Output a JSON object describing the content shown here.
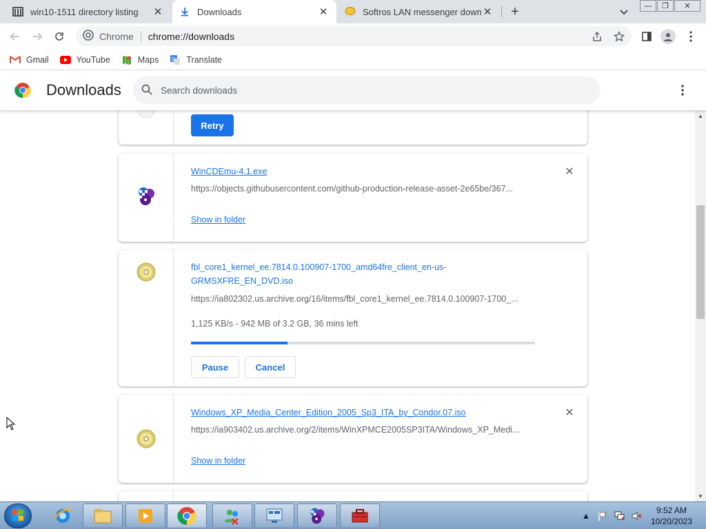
{
  "tabs": [
    {
      "title": "win10-1511 directory listing",
      "icon": "archive-icon"
    },
    {
      "title": "Downloads",
      "icon": "download-icon"
    },
    {
      "title": "Softros LAN messenger downloa",
      "icon": "messenger-icon"
    }
  ],
  "toolbar": {
    "scheme_label": "Chrome",
    "url": "chrome://downloads"
  },
  "bookmarks": [
    {
      "label": "Gmail",
      "icon": "gmail-icon"
    },
    {
      "label": "YouTube",
      "icon": "youtube-icon"
    },
    {
      "label": "Maps",
      "icon": "maps-icon"
    },
    {
      "label": "Translate",
      "icon": "translate-icon"
    }
  ],
  "header": {
    "title": "Downloads",
    "search_placeholder": "Search downloads"
  },
  "downloads": [
    {
      "retry_label": "Retry"
    },
    {
      "filename": "WinCDEmu-4.1.exe",
      "url": "https://objects.githubusercontent.com/github-production-release-asset-2e65be/367...",
      "action_label": "Show in folder"
    },
    {
      "filename": "fbl_core1_kernel_ee.7814.0.100907-1700_amd64fre_client_en-us-GRMSXFRE_EN_DVD.iso",
      "url": "https://ia802302.us.archive.org/16/items/fbl_core1_kernel_ee.7814.0.100907-1700_...",
      "status": "1,125 KB/s - 942 MB of 3.2 GB, 36 mins left",
      "progress_fraction": 0.28,
      "pause_label": "Pause",
      "cancel_label": "Cancel"
    },
    {
      "filename": "Windows_XP_Media_Center_Edition_2005_Sp3_ITA_by_Condor.07.iso",
      "url": "https://ia903402.us.archive.org/2/items/WinXPMCE2005SP3ITA/Windows_XP_Medi...",
      "action_label": "Show in folder"
    }
  ],
  "taskbar": {
    "clock_time": "9:52 AM",
    "clock_date": "10/20/2023"
  },
  "colors": {
    "accent": "#1a73e8",
    "tabstrip": "#dee1e6",
    "omnibox": "#f1f3f4"
  }
}
